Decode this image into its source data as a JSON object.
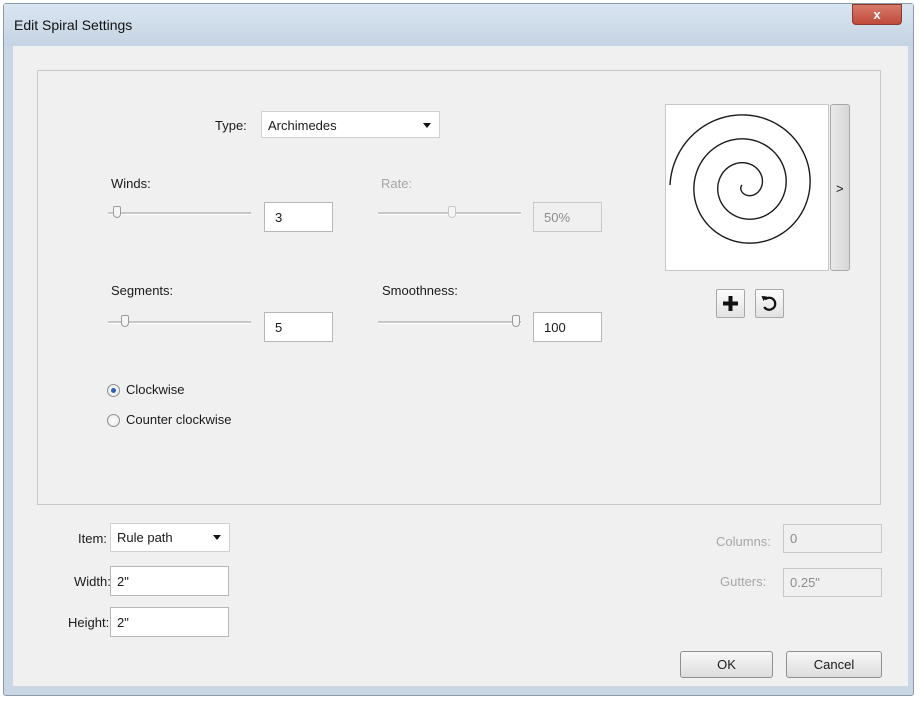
{
  "window": {
    "title": "Edit Spiral Settings",
    "close_label": "x"
  },
  "type": {
    "label": "Type:",
    "value": "Archimedes"
  },
  "winds": {
    "label": "Winds:",
    "value": "3",
    "slider_fraction": 0.05
  },
  "rate": {
    "label": "Rate:",
    "value": "50%",
    "slider_fraction": 0.5,
    "enabled": false
  },
  "segments": {
    "label": "Segments:",
    "value": "5",
    "slider_fraction": 0.12
  },
  "smoothness": {
    "label": "Smoothness:",
    "value": "100",
    "slider_fraction": 1.0
  },
  "direction": {
    "options": [
      {
        "label": "Clockwise",
        "selected": true
      },
      {
        "label": "Counter clockwise",
        "selected": false
      }
    ]
  },
  "preview": {
    "expand_label": ">",
    "add_icon": "plus-icon",
    "reset_icon": "rotate-ccw-icon"
  },
  "item": {
    "label": "Item:",
    "value": "Rule path"
  },
  "width": {
    "label": "Width:",
    "value": "2\""
  },
  "height": {
    "label": "Height:",
    "value": "2\""
  },
  "columns": {
    "label": "Columns:",
    "value": "0",
    "enabled": false
  },
  "gutters": {
    "label": "Gutters:",
    "value": "0.25\"",
    "enabled": false
  },
  "buttons": {
    "ok": "OK",
    "cancel": "Cancel"
  },
  "colors": {
    "title_bar": "#c9d6e3",
    "close_button": "#c7503f",
    "radio_selected": "#2a62b8"
  }
}
